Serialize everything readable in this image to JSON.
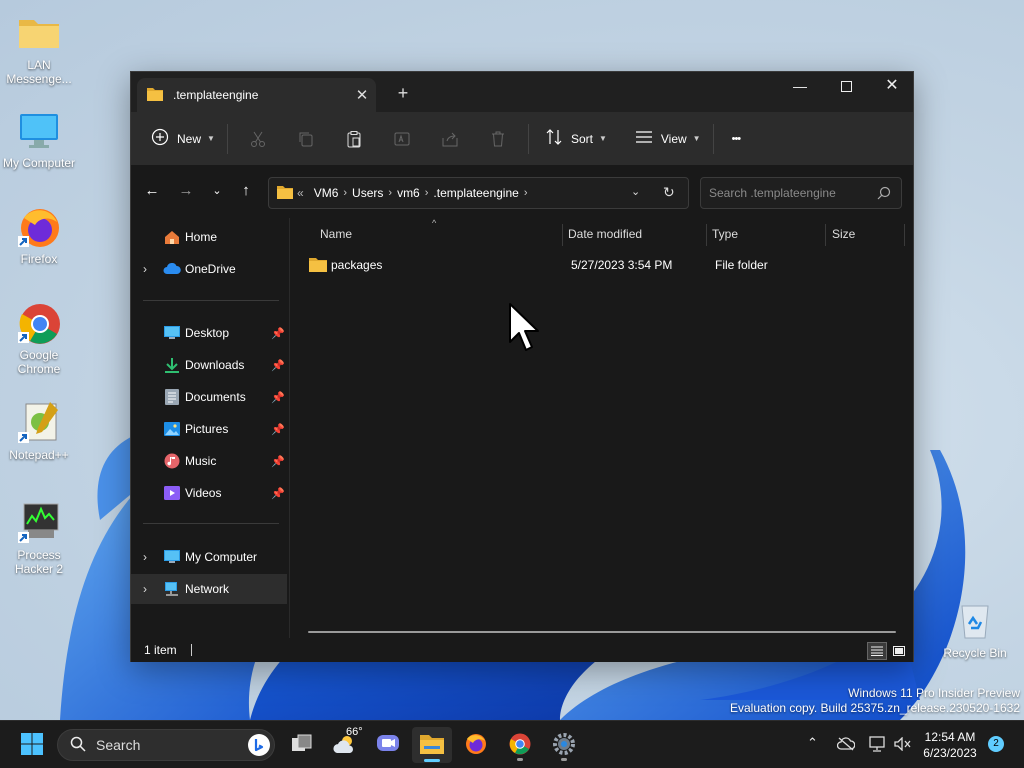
{
  "desktop": {
    "icons": [
      {
        "label": "LAN Messenge..."
      },
      {
        "label": "My Computer"
      },
      {
        "label": "Firefox"
      },
      {
        "label": "Google Chrome"
      },
      {
        "label": "Notepad++"
      },
      {
        "label": "Process Hacker 2"
      },
      {
        "label": "Recycle Bin"
      }
    ],
    "watermark_line1": "Windows 11 Pro Insider Preview",
    "watermark_line2": "Evaluation copy. Build 25375.zn_release.230520-1632"
  },
  "explorer": {
    "tab_title": ".templateengine",
    "toolbar": {
      "new_label": "New",
      "sort_label": "Sort",
      "view_label": "View",
      "more_label": "•••"
    },
    "address": {
      "overflow": "«",
      "crumbs": [
        "VM6",
        "Users",
        "vm6",
        ".templateengine"
      ]
    },
    "search_placeholder": "Search .templateengine",
    "sidebar": {
      "home": "Home",
      "onedrive": "OneDrive",
      "quick": [
        {
          "label": "Desktop"
        },
        {
          "label": "Downloads"
        },
        {
          "label": "Documents"
        },
        {
          "label": "Pictures"
        },
        {
          "label": "Music"
        },
        {
          "label": "Videos"
        }
      ],
      "my_computer": "My Computer",
      "network": "Network"
    },
    "columns": {
      "name": "Name",
      "date": "Date modified",
      "type": "Type",
      "size": "Size"
    },
    "rows": [
      {
        "name": "packages",
        "date": "5/27/2023 3:54 PM",
        "type": "File folder",
        "size": ""
      }
    ],
    "status": "1 item"
  },
  "taskbar": {
    "search_label": "Search",
    "weather_temp": "66°",
    "time": "12:54 AM",
    "date": "6/23/2023",
    "notification_count": "2"
  },
  "colors": {
    "accent": "#60cdff",
    "folder": "#f5c042",
    "window_bg": "#191919",
    "toolbar_bg": "#2c2c2c"
  }
}
